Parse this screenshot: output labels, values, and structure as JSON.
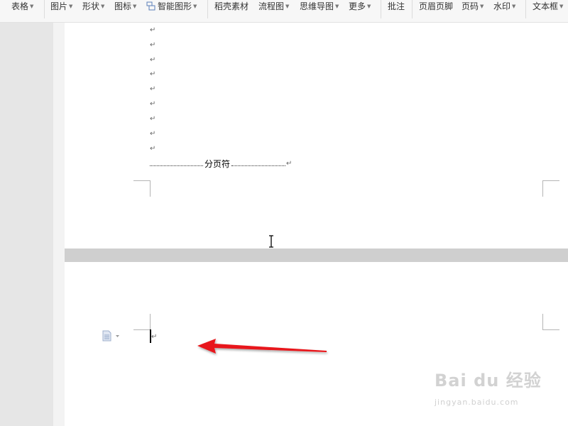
{
  "toolbar": {
    "items": [
      {
        "label": "表格",
        "dropdown": true
      },
      {
        "label": "图片",
        "dropdown": true
      },
      {
        "label": "形状",
        "dropdown": true
      },
      {
        "label": "图标",
        "dropdown": true
      },
      {
        "label": "智能图形",
        "dropdown": true
      },
      {
        "label": "稻壳素材",
        "dropdown": false
      },
      {
        "label": "流程图",
        "dropdown": true
      },
      {
        "label": "思维导图",
        "dropdown": true
      },
      {
        "label": "更多",
        "dropdown": true
      },
      {
        "label": "批注",
        "dropdown": false
      },
      {
        "label": "页眉页脚",
        "dropdown": false
      },
      {
        "label": "页码",
        "dropdown": true
      },
      {
        "label": "水印",
        "dropdown": true
      },
      {
        "label": "文本框",
        "dropdown": true
      }
    ]
  },
  "document": {
    "paragraph_mark": "↵",
    "page_break_label": "分页符"
  },
  "watermark": {
    "main": "Bai du 经验",
    "sub": "jingyan.baidu.com"
  },
  "colors": {
    "annotation_arrow": "#e8191a"
  }
}
